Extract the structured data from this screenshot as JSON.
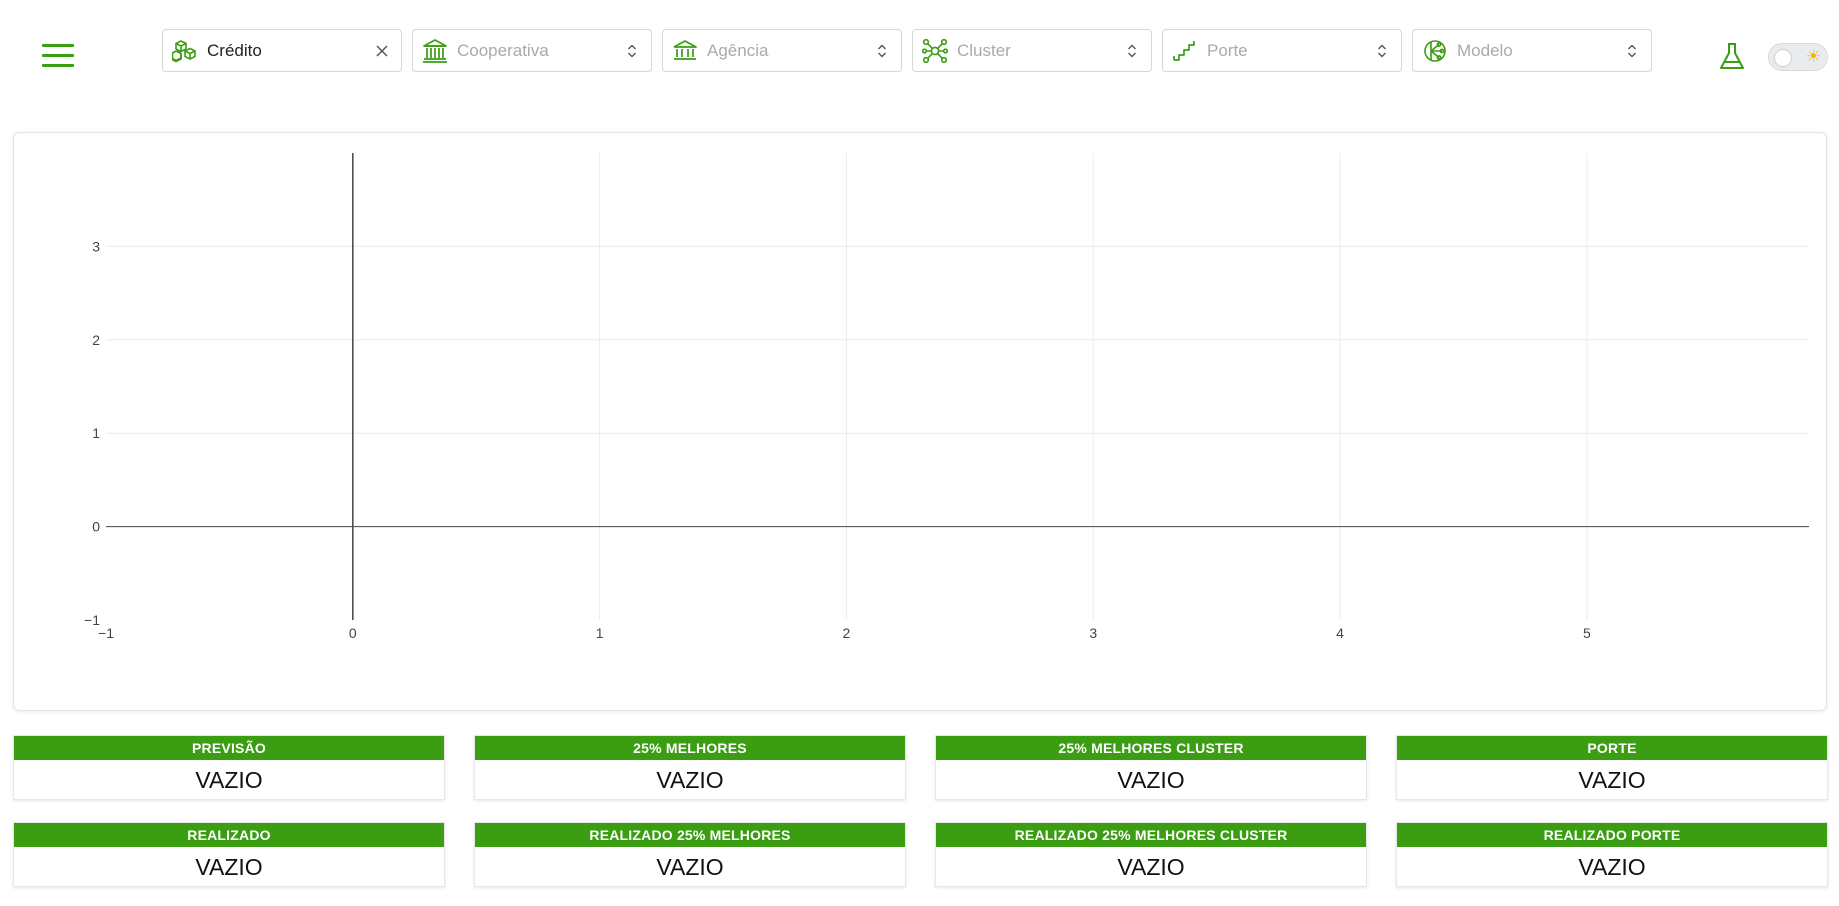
{
  "header": {
    "filters": [
      {
        "name": "credito",
        "label": "Crédito",
        "has_value": true,
        "end_icon": "clear-icon",
        "icon": "boxes-icon"
      },
      {
        "name": "cooperativa",
        "label": "Cooperativa",
        "has_value": false,
        "end_icon": "chevron-updown-icon",
        "icon": "bank-building-icon"
      },
      {
        "name": "agencia",
        "label": "Agência",
        "has_value": false,
        "end_icon": "chevron-updown-icon",
        "icon": "bank-icon"
      },
      {
        "name": "cluster",
        "label": "Cluster",
        "has_value": false,
        "end_icon": "chevron-updown-icon",
        "icon": "network-nodes-icon"
      },
      {
        "name": "porte",
        "label": "Porte",
        "has_value": false,
        "end_icon": "chevron-updown-icon",
        "icon": "stairs-icon"
      },
      {
        "name": "modelo",
        "label": "Modelo",
        "has_value": false,
        "end_icon": "chevron-updown-icon",
        "icon": "model-tree-icon"
      }
    ],
    "theme_toggle": {
      "state": "off",
      "icon": "sun-icon"
    },
    "lab_icon": "flask-icon",
    "menu_icon": "hamburger-menu-icon"
  },
  "colors": {
    "accent": "#3a9d12",
    "placeholder": "#aaaaaa",
    "sun": "#f2b70a"
  },
  "chart_data": {
    "type": "line",
    "series": [],
    "xlim": [
      -1,
      5.9
    ],
    "ylim": [
      -1,
      4
    ],
    "x_ticks": [
      -1,
      0,
      1,
      2,
      3,
      4,
      5
    ],
    "y_ticks": [
      -1,
      0,
      1,
      2,
      3
    ],
    "x_tick_labels": [
      "−1",
      "0",
      "1",
      "2",
      "3",
      "4",
      "5"
    ],
    "y_tick_labels": [
      "−1",
      "0",
      "1",
      "2",
      "3"
    ],
    "grid": true,
    "title": "",
    "xlabel": "",
    "ylabel": ""
  },
  "cards": {
    "row1": [
      {
        "title": "PREVISÃO",
        "value": "VAZIO"
      },
      {
        "title": "25% MELHORES",
        "value": "VAZIO"
      },
      {
        "title": "25% MELHORES CLUSTER",
        "value": "VAZIO"
      },
      {
        "title": "PORTE",
        "value": "VAZIO"
      }
    ],
    "row2": [
      {
        "title": "REALIZADO",
        "value": "VAZIO"
      },
      {
        "title": "REALIZADO 25% MELHORES",
        "value": "VAZIO"
      },
      {
        "title": "REALIZADO 25% MELHORES CLUSTER",
        "value": "VAZIO"
      },
      {
        "title": "REALIZADO PORTE",
        "value": "VAZIO"
      }
    ]
  }
}
